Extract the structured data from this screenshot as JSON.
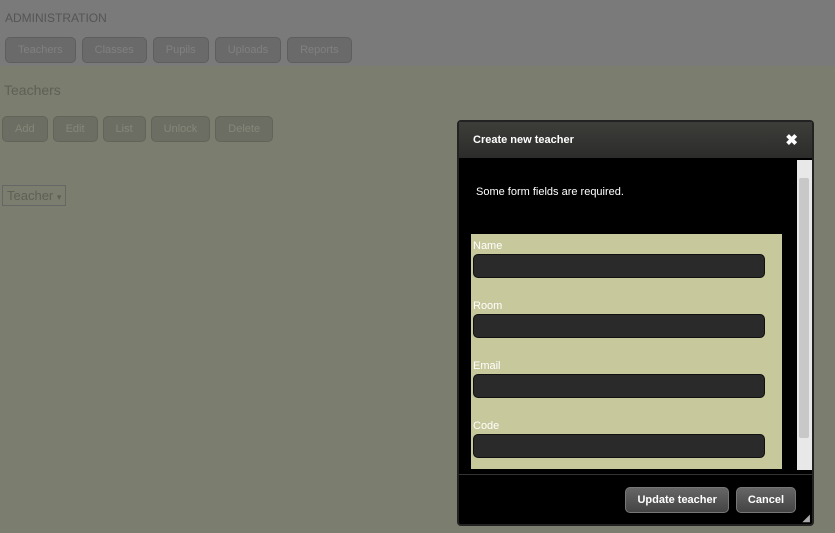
{
  "header": {
    "title": "ADMINISTRATION",
    "nav": [
      "Teachers",
      "Classes",
      "Pupils",
      "Uploads",
      "Reports"
    ]
  },
  "page": {
    "title": "Teachers",
    "tools": [
      "Add",
      "Edit",
      "List",
      "Unlock",
      "Delete"
    ],
    "filter": "Teacher"
  },
  "dialog": {
    "title": "Create new teacher",
    "notice": "Some form fields are required.",
    "fields": [
      "Name",
      "Room",
      "Email",
      "Code"
    ],
    "submit": "Update teacher",
    "cancel": "Cancel"
  }
}
